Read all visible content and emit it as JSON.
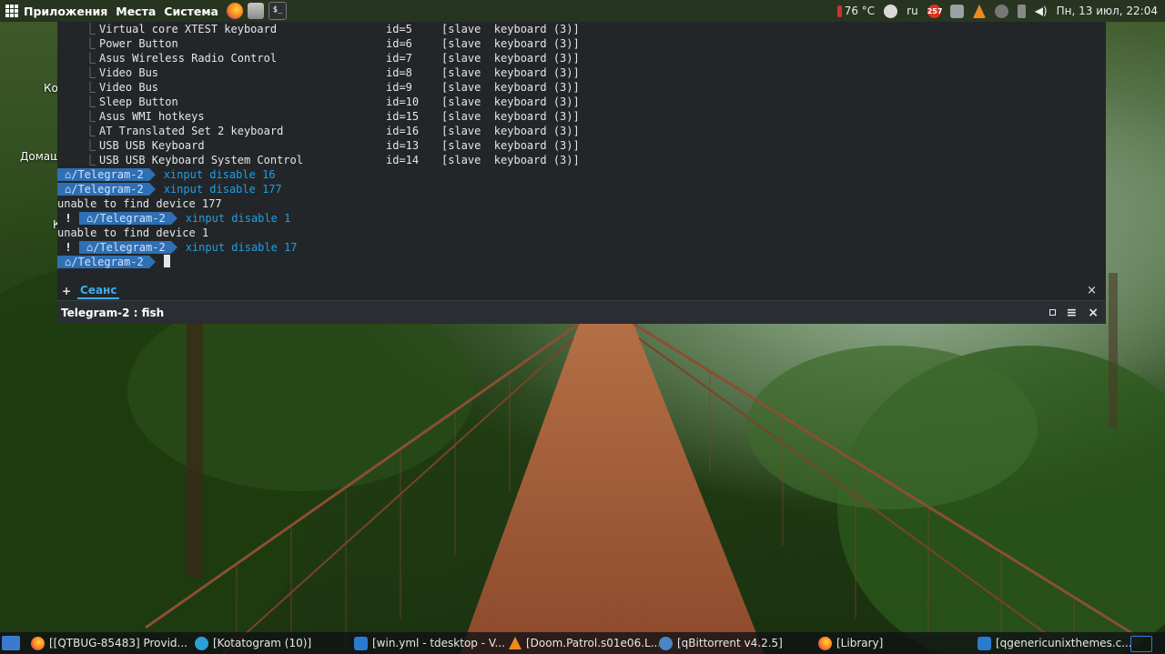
{
  "top_panel": {
    "menu": [
      "Приложения",
      "Места",
      "Система"
    ],
    "launchers": [
      "firefox-icon",
      "files-icon",
      "terminal-icon"
    ],
    "tray": {
      "temperature": "76 °C",
      "keyboard_layout": "ru",
      "badge": "257",
      "datetime": "Пн, 13 июл, 22:04"
    }
  },
  "desktop_labels": [
    "Ко",
    "Домаш",
    "К"
  ],
  "terminal": {
    "devices": [
      {
        "name": "Virtual core XTEST keyboard",
        "id": "id=5",
        "role": "[slave  keyboard (3)]"
      },
      {
        "name": "Power Button",
        "id": "id=6",
        "role": "[slave  keyboard (3)]"
      },
      {
        "name": "Asus Wireless Radio Control",
        "id": "id=7",
        "role": "[slave  keyboard (3)]"
      },
      {
        "name": "Video Bus",
        "id": "id=8",
        "role": "[slave  keyboard (3)]"
      },
      {
        "name": "Video Bus",
        "id": "id=9",
        "role": "[slave  keyboard (3)]"
      },
      {
        "name": "Sleep Button",
        "id": "id=10",
        "role": "[slave  keyboard (3)]"
      },
      {
        "name": "Asus WMI hotkeys",
        "id": "id=15",
        "role": "[slave  keyboard (3)]"
      },
      {
        "name": "AT Translated Set 2 keyboard",
        "id": "id=16",
        "role": "[slave  keyboard (3)]"
      },
      {
        "name": "USB USB Keyboard",
        "id": "id=13",
        "role": "[slave  keyboard (3)]"
      },
      {
        "name": "USB USB Keyboard System Control",
        "id": "id=14",
        "role": "[slave  keyboard (3)]"
      }
    ],
    "tree_glyph": "⎿",
    "prompt_path": "⌂/Telegram-2",
    "error_mark": "!",
    "history": [
      {
        "type": "prompt",
        "error": false,
        "command": "xinput disable 16"
      },
      {
        "type": "prompt",
        "error": false,
        "command": "xinput disable 177"
      },
      {
        "type": "output",
        "text": "unable to find device 177"
      },
      {
        "type": "prompt",
        "error": true,
        "command": "xinput disable 1"
      },
      {
        "type": "output",
        "text": "unable to find device 1"
      },
      {
        "type": "prompt",
        "error": true,
        "command": "xinput disable 17"
      },
      {
        "type": "prompt",
        "error": false,
        "command": ""
      }
    ],
    "tab_plus": "+",
    "tab_label": "Сеанс",
    "tab_close": "×",
    "status_title": "Telegram-2 : fish",
    "window_menu": "≡",
    "window_close": "×"
  },
  "taskbar": {
    "tasks": [
      {
        "icon": "firefox-icon",
        "label": "[[QTBUG-85483] Provid..."
      },
      {
        "icon": "telegram-icon",
        "label": "[Kotatogram (10)]"
      },
      {
        "icon": "vscode-icon",
        "label": "[win.yml - tdesktop - V..."
      },
      {
        "icon": "vlc-icon",
        "label": "[Doom.Patrol.s01e06.L..."
      },
      {
        "icon": "qbittorrent-icon",
        "label": "[qBittorrent v4.2.5]"
      },
      {
        "icon": "firefox-icon",
        "label": "[Library]"
      },
      {
        "icon": "vscode-icon",
        "label": "[qgenericunixthemes.c..."
      }
    ]
  }
}
